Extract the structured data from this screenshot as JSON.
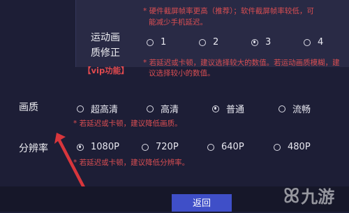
{
  "motion_quality": {
    "hint_top_line1": "* 硬件截屏帧率更高（推荐）；软件截屏帧率较低，可",
    "hint_top_line2": "能减少手机延迟。",
    "label_line1": "运动画",
    "label_line2": "质修正",
    "vip_badge": "【vip功能】",
    "options": [
      {
        "label": "1",
        "selected": false
      },
      {
        "label": "2",
        "selected": false
      },
      {
        "label": "3",
        "selected": true
      },
      {
        "label": "4",
        "selected": false
      }
    ],
    "hint_line1": "* 若延迟或卡顿，建议选择较大的数值。若运动画质模糊，建",
    "hint_line2": "议选择较小的数值。"
  },
  "quality": {
    "label": "画质",
    "options": [
      {
        "label": "超高清",
        "selected": false
      },
      {
        "label": "高清",
        "selected": false
      },
      {
        "label": "普通",
        "selected": true
      },
      {
        "label": "流畅",
        "selected": false
      }
    ],
    "hint": "* 若延迟或卡顿，建议降低画质。"
  },
  "resolution": {
    "label": "分辨率",
    "options": [
      {
        "label": "1080P",
        "selected": true
      },
      {
        "label": "720P",
        "selected": false
      },
      {
        "label": "640P",
        "selected": false
      },
      {
        "label": "480P",
        "selected": false
      }
    ],
    "hint": "* 若延迟或卡顿，建议降低分辨率。"
  },
  "back_button": "返回",
  "watermark": {
    "logo": "ꕤ",
    "text": "九游"
  },
  "colors": {
    "accent": "#3f4fc8",
    "hint_red": "#d94e52",
    "arrow_red": "#d8363c"
  }
}
